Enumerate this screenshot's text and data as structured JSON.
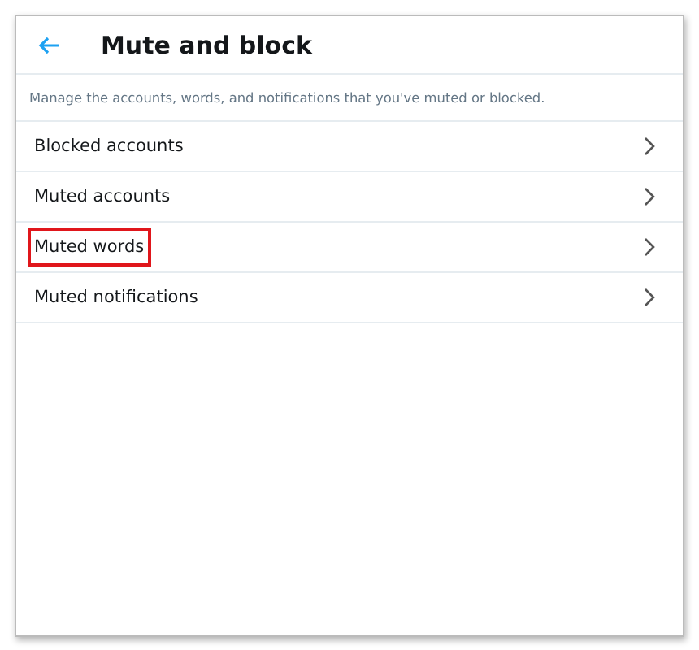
{
  "header": {
    "title": "Mute and block"
  },
  "description": "Manage the accounts, words, and notifications that you've muted or blocked.",
  "items": [
    {
      "label": "Blocked accounts",
      "highlighted": false
    },
    {
      "label": "Muted accounts",
      "highlighted": false
    },
    {
      "label": "Muted words",
      "highlighted": true
    },
    {
      "label": "Muted notifications",
      "highlighted": false
    }
  ]
}
